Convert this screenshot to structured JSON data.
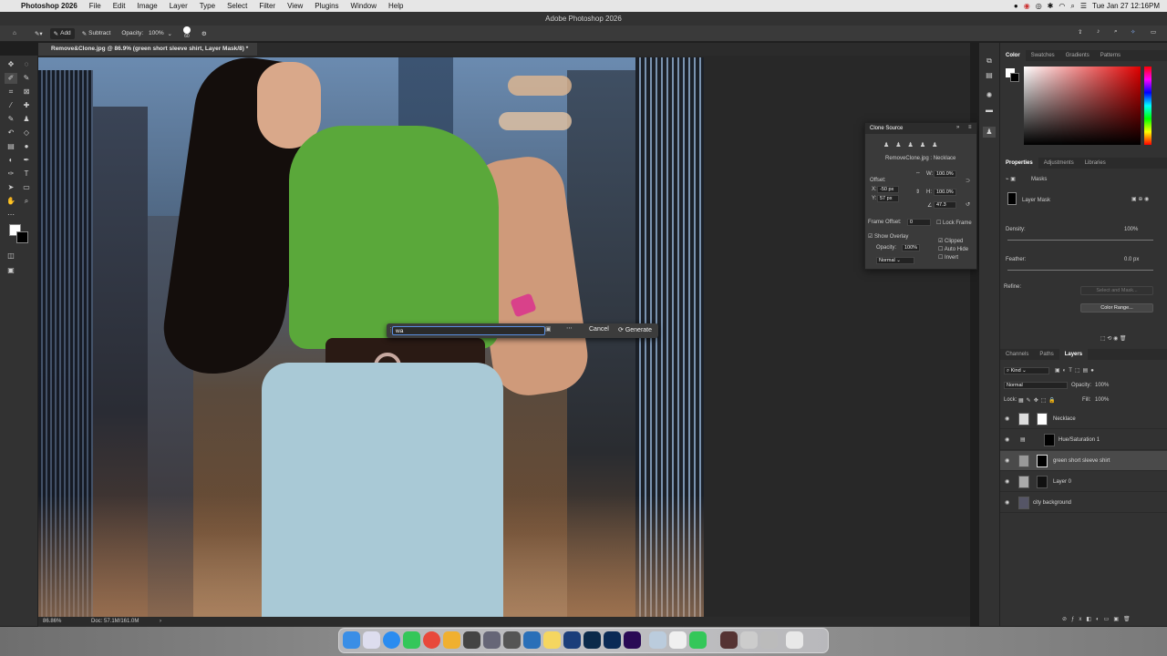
{
  "menubar": {
    "apple": "",
    "items": [
      "Photoshop 2026",
      "File",
      "Edit",
      "Image",
      "Layer",
      "Type",
      "Select",
      "Filter",
      "View",
      "Plugins",
      "Window",
      "Help"
    ],
    "datetime": "Tue Jan 27  12:16PM"
  },
  "window_title": "Adobe Photoshop 2026",
  "options": {
    "add": "Add",
    "subtract": "Subtract",
    "opacity_label": "Opacity:",
    "opacity_value": "100%",
    "brush_size": "60"
  },
  "document_tab": "Remove&Clone.jpg @ 86.9% (green short sleeve shirt, Layer Mask/8) *",
  "status": {
    "zoom": "86.86%",
    "doc": "Doc: 57.1M/161.0M"
  },
  "generate_bar": {
    "input": "wa",
    "cancel": "Cancel",
    "generate": "Generate"
  },
  "clone_source": {
    "title": "Clone Source",
    "source": "RemoveClone.jpg : Necklace",
    "offset_label": "Offset:",
    "x_label": "X:",
    "x": "-50 px",
    "y_label": "Y:",
    "y": "57 px",
    "w_label": "W:",
    "w": "100.0%",
    "h_label": "H:",
    "h": "100.0%",
    "angle": "47.3",
    "frame_offset_label": "Frame Offset:",
    "frame_offset": "0",
    "lock_frame": "Lock Frame",
    "show_overlay": "Show Overlay",
    "opacity_label": "Opacity:",
    "opacity": "100%",
    "blend": "Normal",
    "clipped": "Clipped",
    "auto_hide": "Auto Hide",
    "invert": "Invert"
  },
  "color_panel": {
    "tabs": [
      "Color",
      "Swatches",
      "Gradients",
      "Patterns"
    ]
  },
  "properties": {
    "tabs": [
      "Properties",
      "Adjustments",
      "Libraries"
    ],
    "masks": "Masks",
    "layer_mask": "Layer Mask",
    "density_label": "Density:",
    "density": "100%",
    "feather_label": "Feather:",
    "feather": "0.0 px",
    "refine_label": "Refine:",
    "select_and_mask": "Select and Mask...",
    "color_range": "Color Range..."
  },
  "layers_panel": {
    "tabs": [
      "Channels",
      "Paths",
      "Layers"
    ],
    "kind": "Kind",
    "blend": "Normal",
    "opacity_label": "Opacity:",
    "opacity": "100%",
    "lock_label": "Lock:",
    "fill_label": "Fill:",
    "fill": "100%",
    "layers": [
      {
        "name": "Necklace"
      },
      {
        "name": "Hue/Saturation 1"
      },
      {
        "name": "green short sleeve shirt"
      },
      {
        "name": "Layer 0"
      },
      {
        "name": "city background"
      }
    ]
  },
  "colors": {
    "accent": "#4a89dc",
    "shirt": "#5aa83a",
    "jeans": "#a9c9d6"
  }
}
